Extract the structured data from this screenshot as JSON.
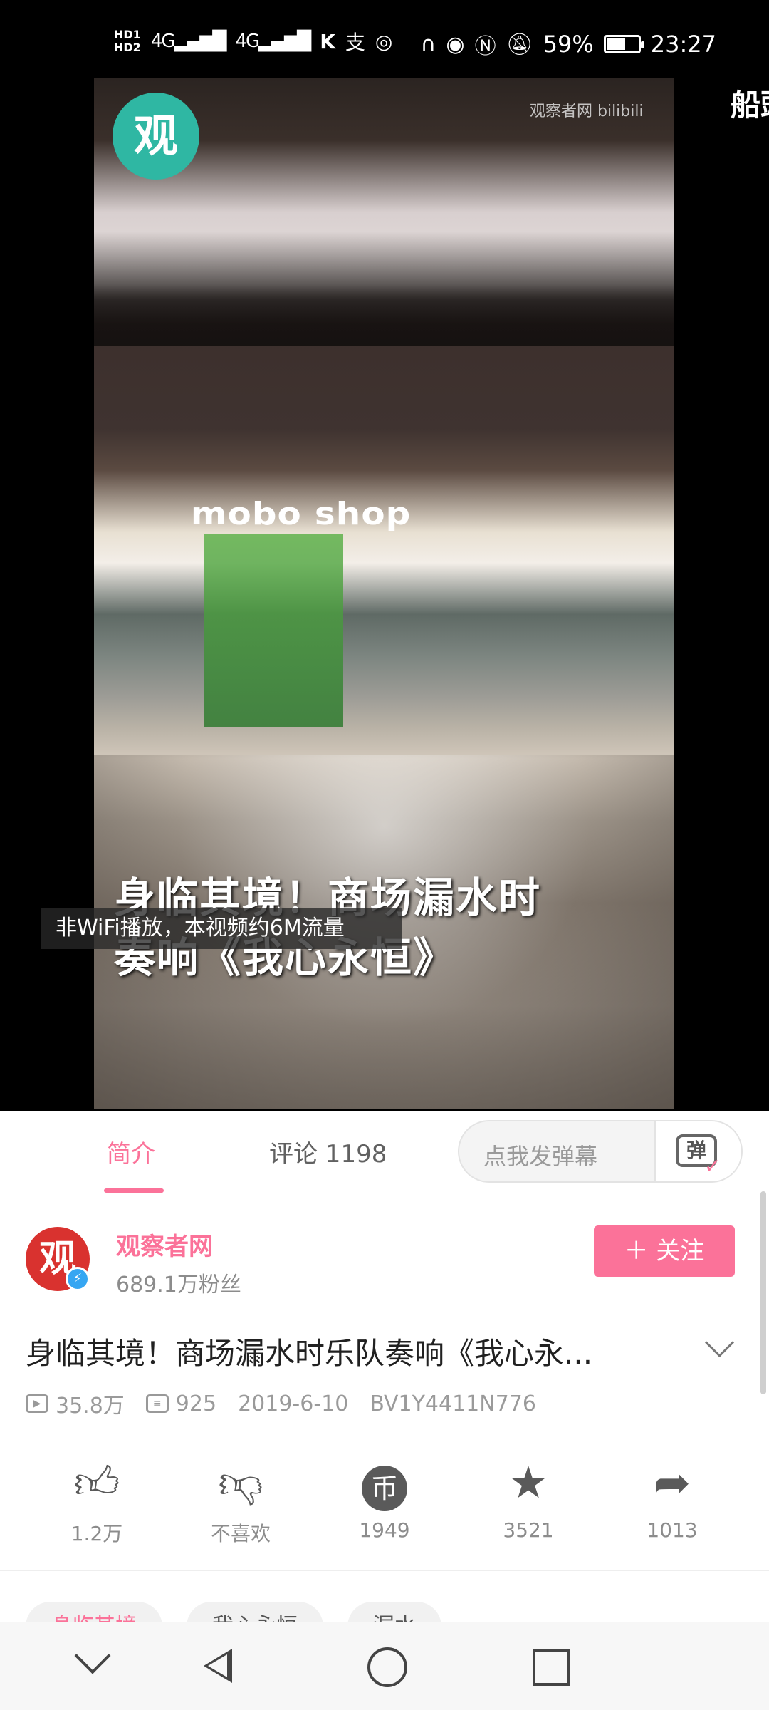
{
  "status_bar": {
    "hd1": "HD1",
    "hd2": "HD2",
    "signal1": "4G",
    "signal2": "4G",
    "extra_icons": [
      "k-icon",
      "alipay-icon",
      "location-icon"
    ],
    "battery_percent": "59%",
    "time": "23:27",
    "battery_level": 0.59
  },
  "player": {
    "watermark": "观察者网 bilibili",
    "logo_text": "观",
    "caption_line1": "身临其境！商场漏水时",
    "caption_line2": "奏响《我心永恒》",
    "shop_sign": "mobo shop",
    "toast": "非WiFi播放，本视频约6M流量",
    "next_title_peek": "船頭"
  },
  "tabs": {
    "intro": "简介",
    "comments": "评论 1198",
    "danmaku_placeholder": "点我发弹幕",
    "danmaku_icon_text": "弹"
  },
  "uploader": {
    "name": "观察者网",
    "fans": "689.1万粉丝",
    "avatar_text": "观",
    "follow_label": "＋ 关注"
  },
  "video": {
    "title": "身临其境！商场漏水时乐队奏响《我心永...",
    "views": "35.8万",
    "danmaku_count": "925",
    "date": "2019-6-10",
    "bvid": "BV1Y4411N776"
  },
  "actions": {
    "like": "1.2万",
    "dislike": "不喜欢",
    "coin": "1949",
    "favorite": "3521",
    "share": "1013"
  },
  "tags": [
    "身临其境",
    "我心永恒",
    "漏水"
  ],
  "colors": {
    "accent": "#fb7299",
    "verified": "#36a6f2"
  }
}
